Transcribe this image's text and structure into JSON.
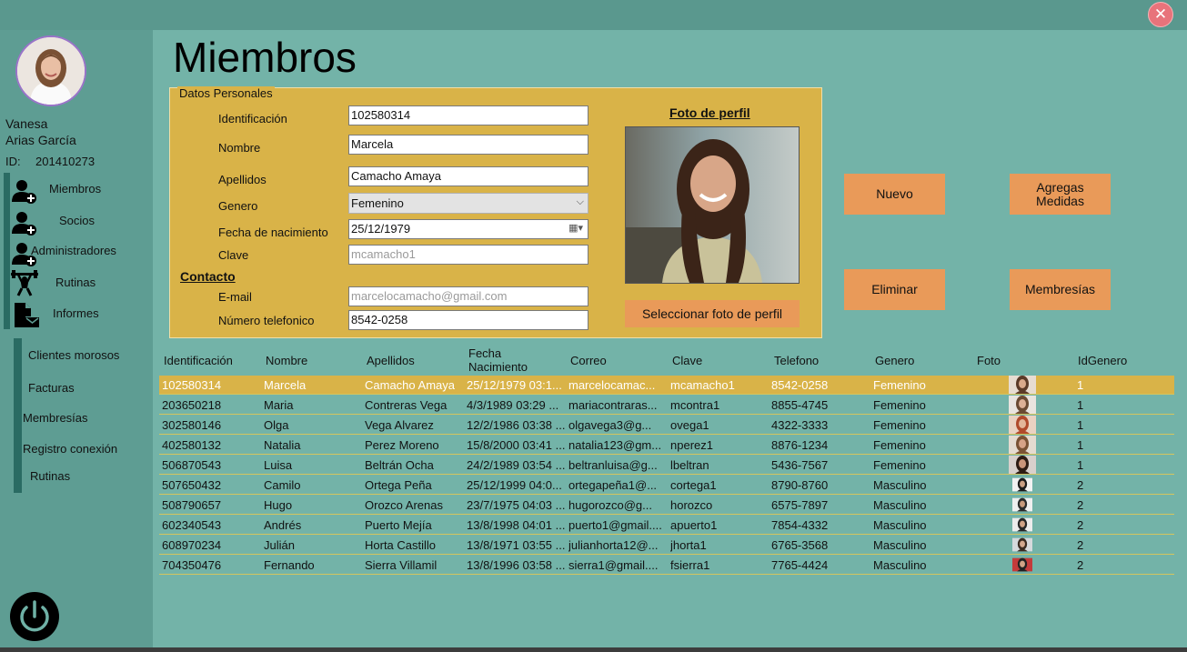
{
  "window": {
    "close_icon": "close-icon"
  },
  "user": {
    "first_name": "Vanesa",
    "last_name": "Arias García",
    "id_label": "ID:",
    "id_value": "201410273"
  },
  "nav": [
    {
      "label": "Miembros",
      "icon": "add-user-icon"
    },
    {
      "label": "Socios",
      "icon": "add-user-icon"
    },
    {
      "label": "Administradores",
      "icon": "add-user-icon"
    },
    {
      "label": "Rutinas",
      "icon": "weightlifter-icon"
    },
    {
      "label": "Informes",
      "icon": "report-mail-icon"
    }
  ],
  "submenu": [
    "Clientes morosos",
    "Facturas",
    "Membresías",
    "Registro conexión",
    "Rutinas"
  ],
  "page_title": "Miembros",
  "form": {
    "group_title": "Datos Personales",
    "identificacion": {
      "label": "Identificación",
      "value": "102580314"
    },
    "nombre": {
      "label": "Nombre",
      "value": "Marcela"
    },
    "apellidos": {
      "label": "Apellidos",
      "value": "Camacho Amaya"
    },
    "genero": {
      "label": "Genero",
      "value": "Femenino"
    },
    "fecha": {
      "label": "Fecha de nacimiento",
      "value": "25/12/1979"
    },
    "clave": {
      "label": "Clave",
      "placeholder": "mcamacho1"
    },
    "contacto_title": "Contacto",
    "email": {
      "label": "E-mail",
      "placeholder": "marcelocamacho@gmail.com"
    },
    "telefono": {
      "label": "Número telefonico",
      "value": "8542-0258"
    },
    "foto_title": "Foto de perfil",
    "select_photo_button": "Seleccionar foto de perfil"
  },
  "actions": {
    "nuevo": "Nuevo",
    "agregar": "Agregas Medidas",
    "eliminar": "Eliminar",
    "membresias": "Membresías"
  },
  "table": {
    "headers": [
      "Identificación",
      "Nombre",
      "Apellidos",
      "Fecha Nacimiento",
      "Correo",
      "Clave",
      "Telefono",
      "Genero",
      "Foto",
      "IdGenero"
    ],
    "rows": [
      [
        "102580314",
        "Marcela",
        "Camacho Amaya",
        "25/12/1979 03:1...",
        "marcelocamac...",
        "mcamacho1",
        "8542-0258",
        "Femenino",
        "",
        "1"
      ],
      [
        "203650218",
        "Maria",
        "Contreras Vega",
        "4/3/1989 03:29 ...",
        "mariacontraras...",
        "mcontra1",
        "8855-4745",
        "Femenino",
        "",
        "1"
      ],
      [
        "302580146",
        "Olga",
        "Vega Alvarez",
        "12/2/1986 03:38 ...",
        "olgavega3@g...",
        "ovega1",
        "4322-3333",
        "Femenino",
        "",
        "1"
      ],
      [
        "402580132",
        "Natalia",
        "Perez Moreno",
        "15/8/2000 03:41 ...",
        "natalia123@gm...",
        "nperez1",
        "8876-1234",
        "Femenino",
        "",
        "1"
      ],
      [
        "506870543",
        "Luisa",
        "Beltrán Ocha",
        "24/2/1989 03:54 ...",
        "beltranluisa@g...",
        "lbeltran",
        "5436-7567",
        "Femenino",
        "",
        "1"
      ],
      [
        "507650432",
        "Camilo",
        "Ortega Peña",
        "25/12/1999 04:0...",
        "ortegapeña1@...",
        "cortega1",
        "8790-8760",
        "Masculino",
        "",
        "2"
      ],
      [
        "508790657",
        "Hugo",
        "Orozco Arenas",
        "23/7/1975 04:03 ...",
        "hugorozco@g...",
        "horozco",
        "6575-7897",
        "Masculino",
        "",
        "2"
      ],
      [
        "602340543",
        "Andrés",
        "Puerto Mejía",
        "13/8/1998 04:01 ...",
        "puerto1@gmail....",
        "apuerto1",
        "7854-4332",
        "Masculino",
        "",
        "2"
      ],
      [
        "608970234",
        "Julián",
        "Horta Castillo",
        "13/8/1971 03:55 ...",
        "julianhorta12@...",
        "jhorta1",
        "6765-3568",
        "Masculino",
        "",
        "2"
      ],
      [
        "704350476",
        "Fernando",
        "Sierra Villamil",
        "13/8/1996 03:58 ...",
        "sierra1@gmail....",
        "fsierra1",
        "7765-4424",
        "Masculino",
        "",
        "2"
      ]
    ]
  },
  "colors": {
    "background": "#73b3a8",
    "sidebar": "#5e9d93",
    "panel": "#d9b348",
    "button": "#e99a59",
    "accent": "#2a6b63"
  }
}
